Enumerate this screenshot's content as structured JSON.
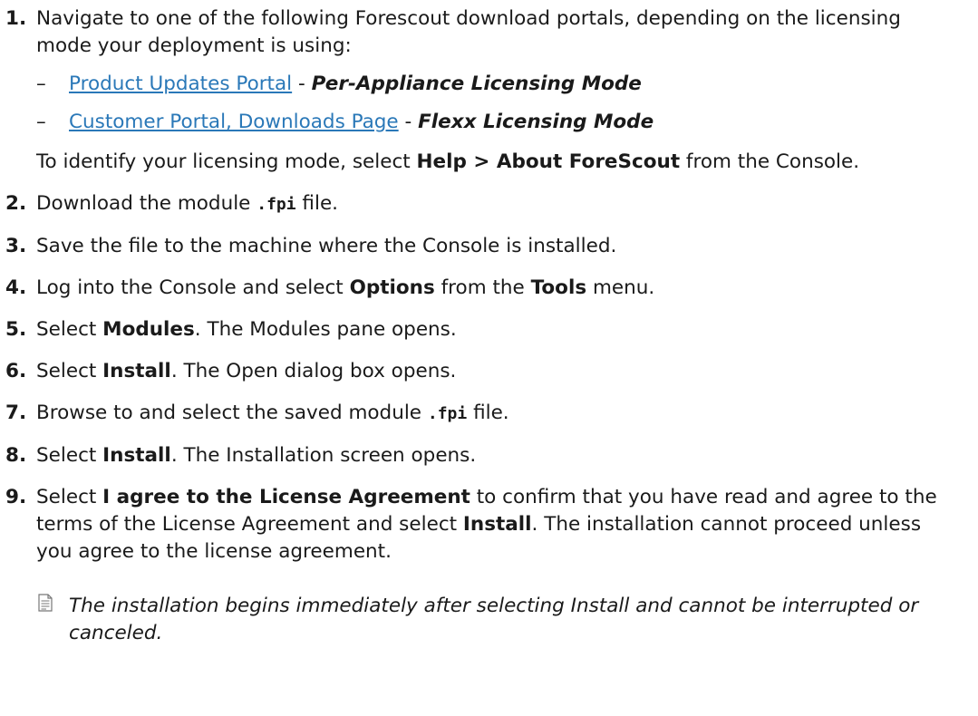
{
  "steps": [
    {
      "num": "1.",
      "text": "Navigate to one of the following Forescout download portals, depending on the licensing mode your deployment is using:",
      "subitems": [
        {
          "dash": "–",
          "link": "Product Updates Portal",
          "sep": " - ",
          "mode": "Per-Appliance Licensing Mode"
        },
        {
          "dash": "–",
          "link": "Customer Portal, Downloads Page",
          "sep": " - ",
          "mode": "Flexx Licensing Mode"
        }
      ],
      "para": {
        "pre": "To identify your licensing mode, select ",
        "bold": "Help > About ForeScout",
        "post": " from the Console."
      }
    },
    {
      "num": "2.",
      "pre": "Download the module ",
      "code": ".fpi",
      "post": " file."
    },
    {
      "num": "3.",
      "text": "Save the file to the machine where the Console is installed."
    },
    {
      "num": "4.",
      "pre": "Log into the Console and select ",
      "b1": "Options",
      "mid": " from the ",
      "b2": "Tools",
      "post": " menu."
    },
    {
      "num": "5.",
      "pre": "Select ",
      "bold": "Modules",
      "post": ". The Modules pane opens."
    },
    {
      "num": "6.",
      "pre": "Select ",
      "bold": "Install",
      "post": ". The Open dialog box opens."
    },
    {
      "num": "7.",
      "pre": "Browse to and select the saved module ",
      "code": ".fpi",
      "post": " file."
    },
    {
      "num": "8.",
      "pre": "Select ",
      "bold": "Install",
      "post": ". The Installation screen opens."
    },
    {
      "num": "9.",
      "pre": "Select ",
      "b1": "I agree to the License Agreement",
      "mid": " to confirm that you have read and agree to the terms of the License Agreement and select ",
      "b2": "Install",
      "post": ". The installation cannot proceed unless you agree to the license agreement."
    }
  ],
  "note": {
    "icon": "note-icon",
    "text": "The installation begins immediately after selecting Install and cannot be interrupted or canceled."
  },
  "colors": {
    "link": "#2a78b8",
    "text": "#1a1a1a"
  }
}
